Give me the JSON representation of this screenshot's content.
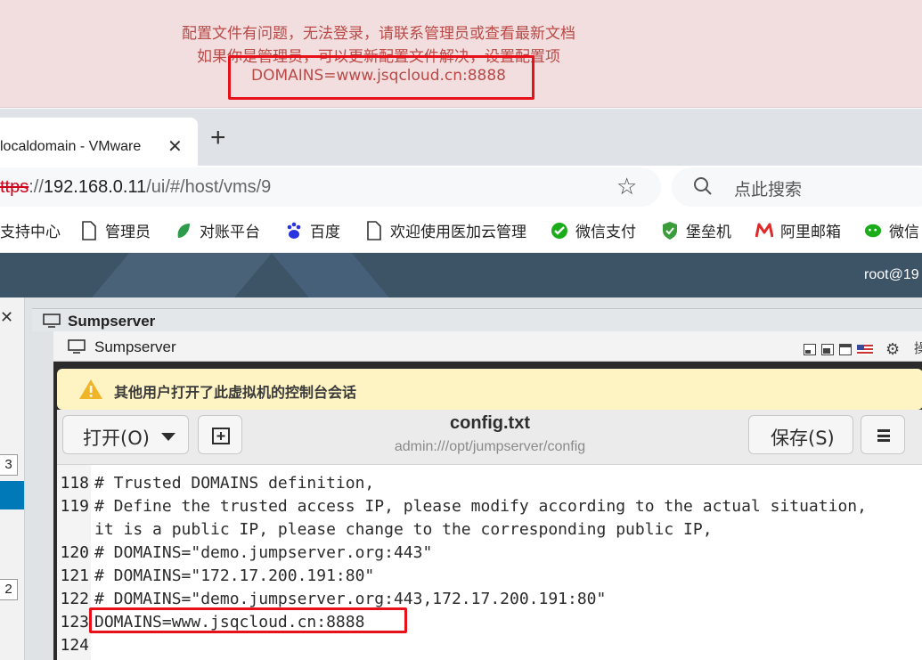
{
  "banner": {
    "line1": "配置文件有问题，无法登录，请联系管理员或查看最新文档",
    "line2": "如果你是管理员，可以更新配置文件解决，设置配置项",
    "line3": "DOMAINS=www.jsqcloud.cn:8888"
  },
  "browser": {
    "tab_title": "localdomain - VMware",
    "url_scheme": "ttps",
    "url_sep": "://",
    "url_host": "192.168.0.11",
    "url_path": "/ui/#/host/vms/9",
    "search_placeholder": "点此搜索",
    "bookmarks": [
      {
        "label": "支持中心",
        "icon": "none"
      },
      {
        "label": "管理员",
        "icon": "page-icon"
      },
      {
        "label": "对账平台",
        "icon": "leaf-icon"
      },
      {
        "label": "百度",
        "icon": "baidu-paw-icon"
      },
      {
        "label": "欢迎使用医加云管理",
        "icon": "page-icon"
      },
      {
        "label": "微信支付",
        "icon": "wechat-pay-icon"
      },
      {
        "label": "堡垒机",
        "icon": "shield-icon"
      },
      {
        "label": "阿里邮箱",
        "icon": "mail-m-icon"
      },
      {
        "label": "微信",
        "icon": "wechat-icon"
      }
    ]
  },
  "vsphere": {
    "user": "root@19",
    "left_badges": [
      "3",
      "2"
    ],
    "outer_title": "Sumpserver"
  },
  "console": {
    "title": "Sumpserver",
    "more_glyph": "操",
    "warning": "其他用户打开了此虚拟机的控制台会话"
  },
  "editor": {
    "open_label": "打开(O)",
    "save_label": "保存(S)",
    "doc_title": "config.txt",
    "doc_path": "admin:///opt/jumpserver/config",
    "lines": [
      {
        "num": "118",
        "text": "# Trusted DOMAINS definition,"
      },
      {
        "num": "119",
        "text": "# Define the trusted access IP, please modify according to the actual situation,"
      },
      {
        "num": "",
        "text": "it is a public IP, please change to the corresponding public IP,"
      },
      {
        "num": "120",
        "text": "# DOMAINS=\"demo.jumpserver.org:443\""
      },
      {
        "num": "121",
        "text": "# DOMAINS=\"172.17.200.191:80\""
      },
      {
        "num": "122",
        "text": "# DOMAINS=\"demo.jumpserver.org:443,172.17.200.191:80\""
      },
      {
        "num": "123",
        "text": "DOMAINS=www.jsqcloud.cn:8888"
      },
      {
        "num": "124",
        "text": ""
      }
    ]
  },
  "colors": {
    "banner_bg": "#f2dede",
    "banner_text": "#b94a48",
    "highlight_box": "#e8111a",
    "vsphere_header": "#3d5366",
    "warning_bg": "#fef4c3"
  }
}
